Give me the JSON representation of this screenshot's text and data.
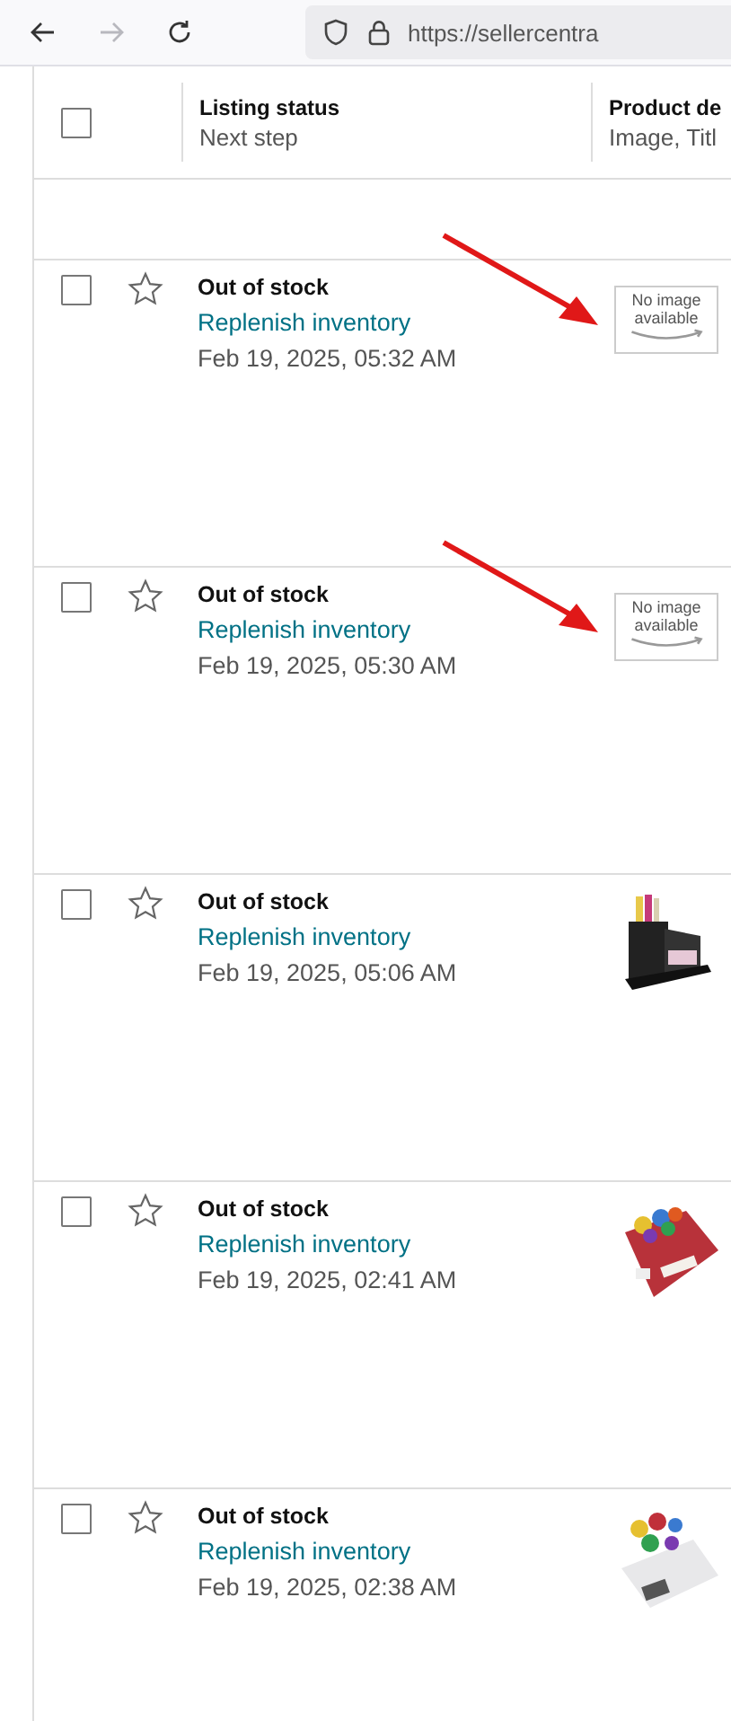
{
  "browser": {
    "url": "https://sellercentra",
    "forward_disabled": true
  },
  "table": {
    "select_all_checked": false,
    "columns": [
      {
        "title": "Listing status",
        "subtitle": "Next step"
      },
      {
        "title": "Product de",
        "subtitle": "Image, Titl"
      }
    ],
    "rows": [
      {
        "checked": false,
        "starred": false,
        "status": "Out of stock",
        "next_step": "Replenish inventory",
        "date": "Feb 19, 2025, 05:32 AM",
        "image": {
          "kind": "placeholder",
          "line1": "No image",
          "line2": "available"
        },
        "arrow": true
      },
      {
        "checked": false,
        "starred": false,
        "status": "Out of stock",
        "next_step": "Replenish inventory",
        "date": "Feb 19, 2025, 05:30 AM",
        "image": {
          "kind": "placeholder",
          "line1": "No image",
          "line2": "available"
        },
        "arrow": true
      },
      {
        "checked": false,
        "starred": false,
        "status": "Out of stock",
        "next_step": "Replenish inventory",
        "date": "Feb 19, 2025, 05:06 AM",
        "arrow": false
      },
      {
        "checked": false,
        "starred": false,
        "status": "Out of stock",
        "next_step": "Replenish inventory",
        "date": "Feb 19, 2025, 02:41 AM",
        "arrow": false
      },
      {
        "checked": false,
        "starred": false,
        "status": "Out of stock",
        "next_step": "Replenish inventory",
        "date": "Feb 19, 2025, 02:38 AM",
        "arrow": false
      }
    ]
  }
}
